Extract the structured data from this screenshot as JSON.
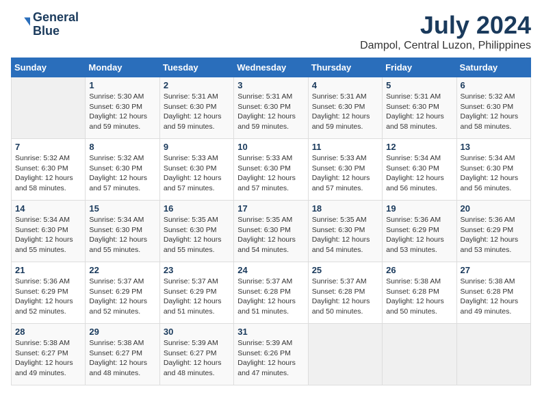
{
  "header": {
    "logo_line1": "General",
    "logo_line2": "Blue",
    "month_year": "July 2024",
    "location": "Dampol, Central Luzon, Philippines"
  },
  "days_of_week": [
    "Sunday",
    "Monday",
    "Tuesday",
    "Wednesday",
    "Thursday",
    "Friday",
    "Saturday"
  ],
  "weeks": [
    [
      {
        "day": "",
        "info": ""
      },
      {
        "day": "1",
        "info": "Sunrise: 5:30 AM\nSunset: 6:30 PM\nDaylight: 12 hours\nand 59 minutes."
      },
      {
        "day": "2",
        "info": "Sunrise: 5:31 AM\nSunset: 6:30 PM\nDaylight: 12 hours\nand 59 minutes."
      },
      {
        "day": "3",
        "info": "Sunrise: 5:31 AM\nSunset: 6:30 PM\nDaylight: 12 hours\nand 59 minutes."
      },
      {
        "day": "4",
        "info": "Sunrise: 5:31 AM\nSunset: 6:30 PM\nDaylight: 12 hours\nand 59 minutes."
      },
      {
        "day": "5",
        "info": "Sunrise: 5:31 AM\nSunset: 6:30 PM\nDaylight: 12 hours\nand 58 minutes."
      },
      {
        "day": "6",
        "info": "Sunrise: 5:32 AM\nSunset: 6:30 PM\nDaylight: 12 hours\nand 58 minutes."
      }
    ],
    [
      {
        "day": "7",
        "info": "Sunrise: 5:32 AM\nSunset: 6:30 PM\nDaylight: 12 hours\nand 58 minutes."
      },
      {
        "day": "8",
        "info": "Sunrise: 5:32 AM\nSunset: 6:30 PM\nDaylight: 12 hours\nand 57 minutes."
      },
      {
        "day": "9",
        "info": "Sunrise: 5:33 AM\nSunset: 6:30 PM\nDaylight: 12 hours\nand 57 minutes."
      },
      {
        "day": "10",
        "info": "Sunrise: 5:33 AM\nSunset: 6:30 PM\nDaylight: 12 hours\nand 57 minutes."
      },
      {
        "day": "11",
        "info": "Sunrise: 5:33 AM\nSunset: 6:30 PM\nDaylight: 12 hours\nand 57 minutes."
      },
      {
        "day": "12",
        "info": "Sunrise: 5:34 AM\nSunset: 6:30 PM\nDaylight: 12 hours\nand 56 minutes."
      },
      {
        "day": "13",
        "info": "Sunrise: 5:34 AM\nSunset: 6:30 PM\nDaylight: 12 hours\nand 56 minutes."
      }
    ],
    [
      {
        "day": "14",
        "info": "Sunrise: 5:34 AM\nSunset: 6:30 PM\nDaylight: 12 hours\nand 55 minutes."
      },
      {
        "day": "15",
        "info": "Sunrise: 5:34 AM\nSunset: 6:30 PM\nDaylight: 12 hours\nand 55 minutes."
      },
      {
        "day": "16",
        "info": "Sunrise: 5:35 AM\nSunset: 6:30 PM\nDaylight: 12 hours\nand 55 minutes."
      },
      {
        "day": "17",
        "info": "Sunrise: 5:35 AM\nSunset: 6:30 PM\nDaylight: 12 hours\nand 54 minutes."
      },
      {
        "day": "18",
        "info": "Sunrise: 5:35 AM\nSunset: 6:30 PM\nDaylight: 12 hours\nand 54 minutes."
      },
      {
        "day": "19",
        "info": "Sunrise: 5:36 AM\nSunset: 6:29 PM\nDaylight: 12 hours\nand 53 minutes."
      },
      {
        "day": "20",
        "info": "Sunrise: 5:36 AM\nSunset: 6:29 PM\nDaylight: 12 hours\nand 53 minutes."
      }
    ],
    [
      {
        "day": "21",
        "info": "Sunrise: 5:36 AM\nSunset: 6:29 PM\nDaylight: 12 hours\nand 52 minutes."
      },
      {
        "day": "22",
        "info": "Sunrise: 5:37 AM\nSunset: 6:29 PM\nDaylight: 12 hours\nand 52 minutes."
      },
      {
        "day": "23",
        "info": "Sunrise: 5:37 AM\nSunset: 6:29 PM\nDaylight: 12 hours\nand 51 minutes."
      },
      {
        "day": "24",
        "info": "Sunrise: 5:37 AM\nSunset: 6:28 PM\nDaylight: 12 hours\nand 51 minutes."
      },
      {
        "day": "25",
        "info": "Sunrise: 5:37 AM\nSunset: 6:28 PM\nDaylight: 12 hours\nand 50 minutes."
      },
      {
        "day": "26",
        "info": "Sunrise: 5:38 AM\nSunset: 6:28 PM\nDaylight: 12 hours\nand 50 minutes."
      },
      {
        "day": "27",
        "info": "Sunrise: 5:38 AM\nSunset: 6:28 PM\nDaylight: 12 hours\nand 49 minutes."
      }
    ],
    [
      {
        "day": "28",
        "info": "Sunrise: 5:38 AM\nSunset: 6:27 PM\nDaylight: 12 hours\nand 49 minutes."
      },
      {
        "day": "29",
        "info": "Sunrise: 5:38 AM\nSunset: 6:27 PM\nDaylight: 12 hours\nand 48 minutes."
      },
      {
        "day": "30",
        "info": "Sunrise: 5:39 AM\nSunset: 6:27 PM\nDaylight: 12 hours\nand 48 minutes."
      },
      {
        "day": "31",
        "info": "Sunrise: 5:39 AM\nSunset: 6:26 PM\nDaylight: 12 hours\nand 47 minutes."
      },
      {
        "day": "",
        "info": ""
      },
      {
        "day": "",
        "info": ""
      },
      {
        "day": "",
        "info": ""
      }
    ]
  ]
}
